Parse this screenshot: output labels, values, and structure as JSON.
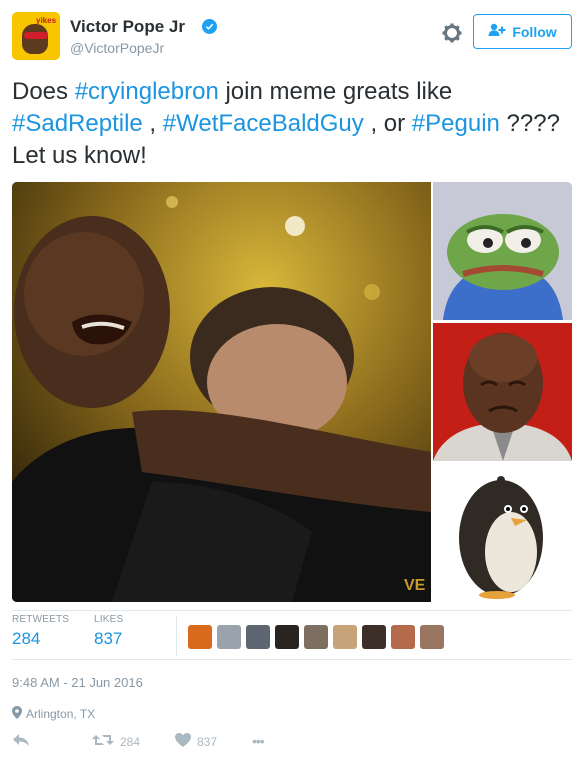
{
  "user": {
    "name": "Victor Pope Jr",
    "handle": "@VictorPopeJr",
    "avatar_tag": "yikes"
  },
  "follow_button": {
    "label": "Follow"
  },
  "tweet": {
    "segments": [
      {
        "text": "Does ",
        "hashtag": false
      },
      {
        "text": "#cryinglebron",
        "hashtag": true
      },
      {
        "text": " join meme greats like ",
        "hashtag": false
      },
      {
        "text": "#SadReptile",
        "hashtag": true
      },
      {
        "text": " , ",
        "hashtag": false
      },
      {
        "text": "#WetFaceBaldGuy",
        "hashtag": true
      },
      {
        "text": " , or ",
        "hashtag": false
      },
      {
        "text": "#Peguin",
        "hashtag": true
      },
      {
        "text": " ???? Let us know!",
        "hashtag": false
      }
    ]
  },
  "stats": {
    "retweets_label": "RETWEETS",
    "retweets_value": "284",
    "likes_label": "LIKES",
    "likes_value": "837",
    "liker_colors": [
      "#d96a1d",
      "#9aa3ad",
      "#5d6670",
      "#2a2420",
      "#7c6f62",
      "#c7a37a",
      "#3b2f28",
      "#b56a4c",
      "#9a7560"
    ]
  },
  "timestamp": "9:48 AM - 21 Jun 2016",
  "location": "Arlington, TX",
  "actions": {
    "retweet_count": "284",
    "like_count": "837",
    "more_label": "•••"
  },
  "colors": {
    "link": "#1b95e0",
    "muted": "#8899a6",
    "accent": "#1da1f2"
  }
}
